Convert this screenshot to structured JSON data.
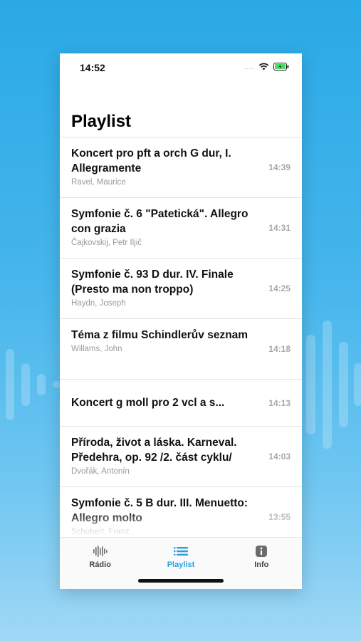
{
  "status": {
    "time": "14:52",
    "dots": "....",
    "accent": "#2b9fdc",
    "battery_color": "#4cd964"
  },
  "title": "Playlist",
  "tracks": [
    {
      "title": "Koncert pro pft a orch G dur, I. Allegramente",
      "artist": "Ravel, Maurice",
      "duration": "14:39"
    },
    {
      "title": "Symfonie č. 6 \"Patetická\". Allegro con grazia",
      "artist": "Čajkovskij, Petr Iljič",
      "duration": "14:31"
    },
    {
      "title": "Symfonie č. 93 D dur. IV. Finale (Presto ma non troppo)",
      "artist": "Haydn, Joseph",
      "duration": "14:25"
    },
    {
      "title": "Téma z filmu Schindlerův seznam",
      "artist": "Willams, John",
      "duration": "14:18"
    },
    {
      "title": "Koncert g moll pro 2 vcl a s...",
      "artist": "",
      "duration": "14:13"
    },
    {
      "title": "Příroda, život a láska. Karneval. Předehra, op. 92 /2. část cyklu/",
      "artist": "Dvořák, Antonín",
      "duration": "14:03"
    },
    {
      "title": "Symfonie č. 5 B dur. III. Menuetto: Allegro molto",
      "artist": "Schubert, Franz",
      "duration": "13:55"
    }
  ],
  "tabs": [
    {
      "label": "Rádio",
      "icon": "waveform-icon",
      "active": false
    },
    {
      "label": "Playlist",
      "icon": "list-icon",
      "active": true
    },
    {
      "label": "Info",
      "icon": "info-icon",
      "active": false
    }
  ]
}
